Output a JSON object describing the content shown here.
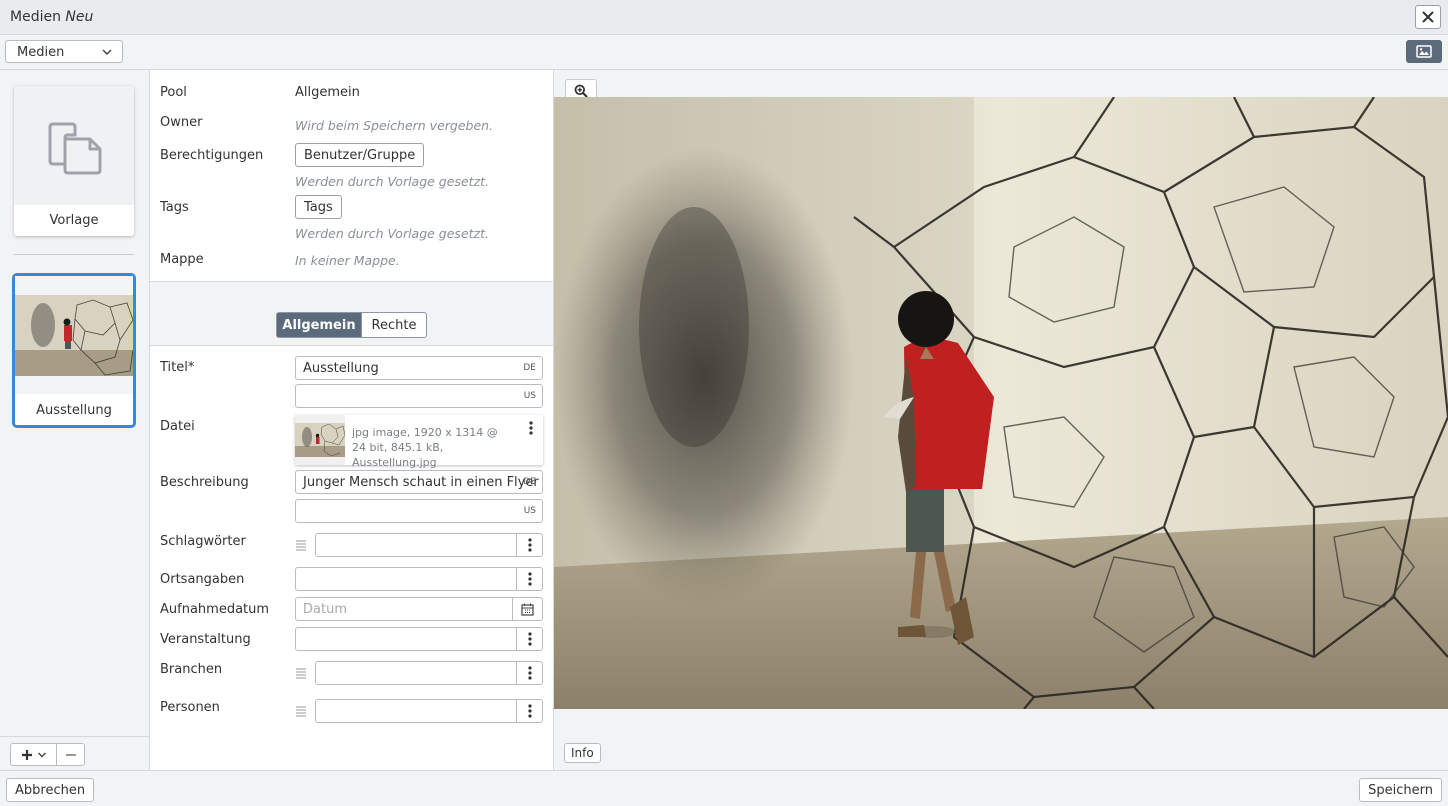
{
  "window": {
    "title": "Medien",
    "title_state": "Neu"
  },
  "toolbar": {
    "select_value": "Medien"
  },
  "sidebar": {
    "template_label": "Vorlage",
    "media_label": "Ausstellung"
  },
  "form": {
    "pool_label": "Pool",
    "pool_value": "Allgemein",
    "owner_label": "Owner",
    "owner_hint": "Wird beim Speichern vergeben.",
    "perm_label": "Berechtigungen",
    "perm_button": "Benutzer/Gruppe",
    "perm_hint": "Werden durch Vorlage gesetzt.",
    "tags_label": "Tags",
    "tags_button": "Tags",
    "tags_hint": "Werden durch Vorlage gesetzt.",
    "folder_label": "Mappe",
    "folder_hint": "In keiner Mappe.",
    "tabs": [
      {
        "label": "Allgemein",
        "active": true
      },
      {
        "label": "Rechte",
        "active": false
      }
    ],
    "title_label": "Titel*",
    "title_de": "Ausstellung",
    "title_us": "",
    "file_label": "Datei",
    "file_info": "jpg image, 1920 x 1314 @ 24 bit, 845.1 kB, Ausstellung.jpg",
    "desc_label": "Beschreibung",
    "desc_de": "Junger Mensch schaut in einen Flyer",
    "desc_us": "",
    "keywords_label": "Schlagwörter",
    "location_label": "Ortsangaben",
    "date_label": "Aufnahmedatum",
    "date_placeholder": "Datum",
    "event_label": "Veranstaltung",
    "industries_label": "Branchen",
    "persons_label": "Personen",
    "lang_de": "DE",
    "lang_us": "US"
  },
  "preview": {
    "info_button": "Info"
  },
  "footer": {
    "cancel": "Abbrechen",
    "save": "Speichern"
  }
}
